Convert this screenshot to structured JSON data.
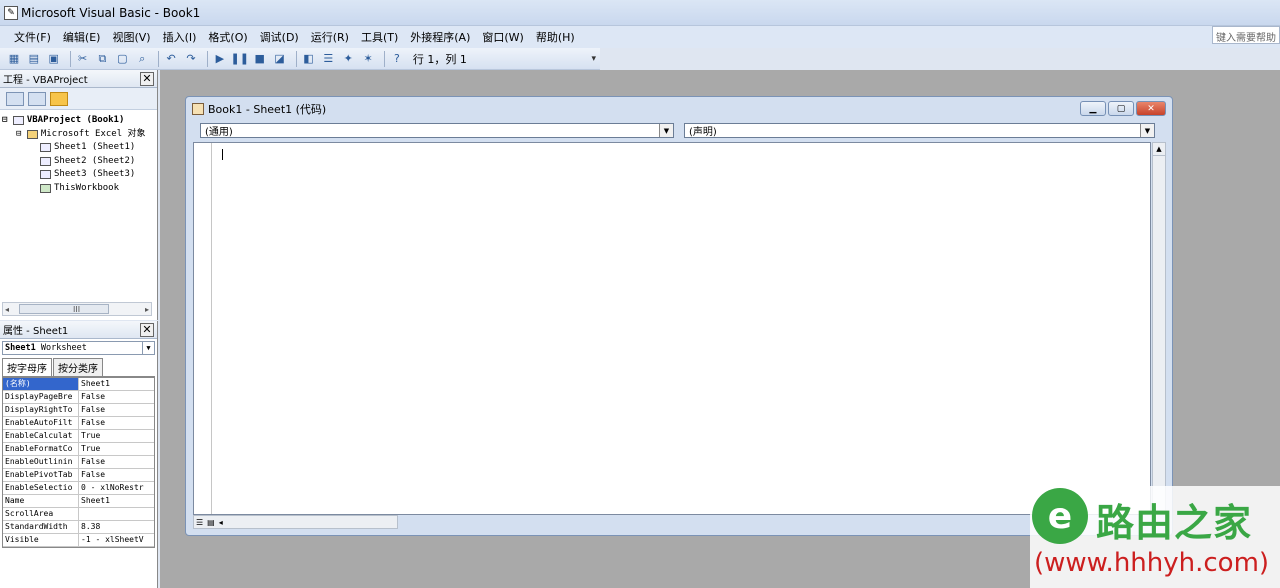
{
  "window": {
    "title": "Microsoft Visual Basic - Book1"
  },
  "menu": {
    "items": [
      "文件(F)",
      "编辑(E)",
      "视图(V)",
      "插入(I)",
      "格式(O)",
      "调试(D)",
      "运行(R)",
      "工具(T)",
      "外接程序(A)",
      "窗口(W)",
      "帮助(H)"
    ],
    "help_placeholder": "键入需要帮助"
  },
  "toolbar": {
    "position": "行 1，列 1"
  },
  "project": {
    "title": "工程 - VBAProject",
    "tree": {
      "root": "VBAProject (Book1)",
      "folder": "Microsoft Excel 对象",
      "items": [
        "Sheet1 (Sheet1)",
        "Sheet2 (Sheet2)",
        "Sheet3 (Sheet3)",
        "ThisWorkbook"
      ]
    },
    "scroll_mid": "III"
  },
  "properties": {
    "title": "属性 - Sheet1",
    "object_name": "Sheet1",
    "object_type": "Worksheet",
    "tabs": [
      "按字母序",
      "按分类序"
    ],
    "rows": [
      {
        "name": "(名称)",
        "value": "Sheet1"
      },
      {
        "name": "DisplayPageBre",
        "value": "False"
      },
      {
        "name": "DisplayRightTo",
        "value": "False"
      },
      {
        "name": "EnableAutoFilt",
        "value": "False"
      },
      {
        "name": "EnableCalculat",
        "value": "True"
      },
      {
        "name": "EnableFormatCo",
        "value": "True"
      },
      {
        "name": "EnableOutlinin",
        "value": "False"
      },
      {
        "name": "EnablePivotTab",
        "value": "False"
      },
      {
        "name": "EnableSelectio",
        "value": "0 - xlNoRestr"
      },
      {
        "name": "Name",
        "value": "Sheet1"
      },
      {
        "name": "ScrollArea",
        "value": ""
      },
      {
        "name": "StandardWidth",
        "value": "8.38"
      },
      {
        "name": "Visible",
        "value": "-1 - xlSheetV"
      }
    ]
  },
  "code_window": {
    "title": "Book1 - Sheet1 (代码)",
    "object_combo": "(通用)",
    "proc_combo": "(声明)"
  },
  "watermark": {
    "brand": "路由之家",
    "url": "(www.hhhyh.com)",
    "logo_letter": "e"
  }
}
